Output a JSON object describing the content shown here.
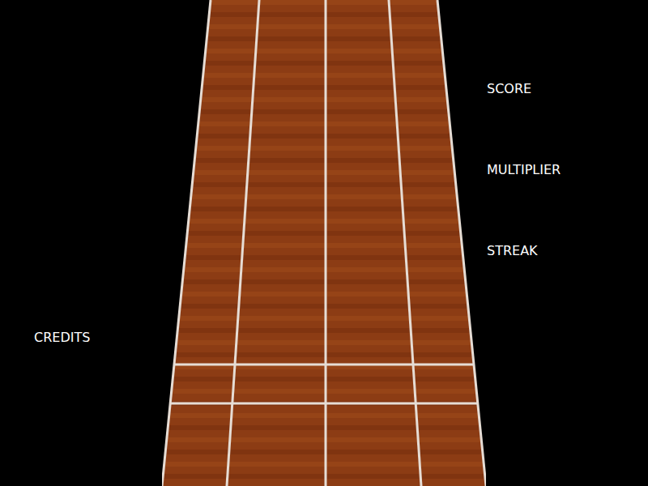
{
  "hud": {
    "left": [
      "CREDITS"
    ],
    "right": [
      "SCORE",
      "MULTIPLIER",
      "STREAK"
    ]
  }
}
